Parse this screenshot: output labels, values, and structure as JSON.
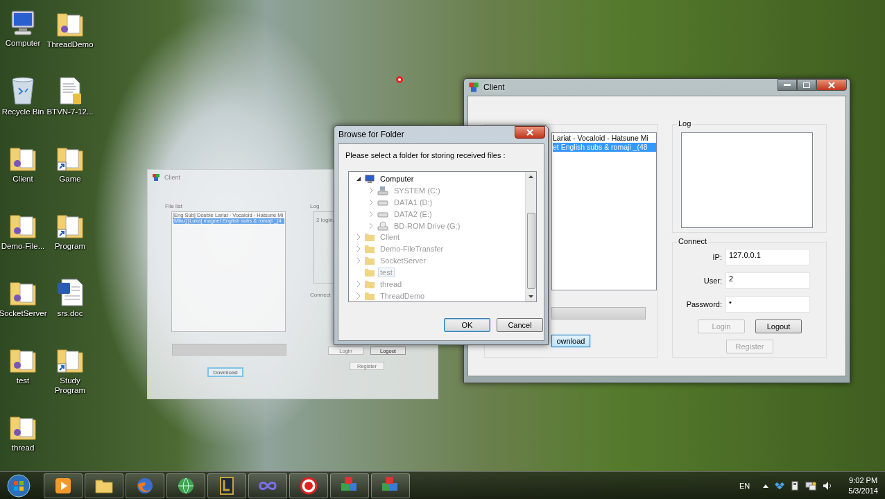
{
  "desktop_icons": [
    {
      "label": "Computer",
      "kind": "computer"
    },
    {
      "label": "Recycle Bin",
      "kind": "recycle"
    },
    {
      "label": "Client",
      "kind": "folder"
    },
    {
      "label": "Demo-File...",
      "kind": "folder"
    },
    {
      "label": "SocketServer",
      "kind": "folder"
    },
    {
      "label": "test",
      "kind": "folder"
    },
    {
      "label": "thread",
      "kind": "folder"
    },
    {
      "label": "ThreadDemo",
      "kind": "folder"
    },
    {
      "label": "BTVN-7-12...",
      "kind": "document"
    },
    {
      "label": "Game",
      "kind": "shortcut"
    },
    {
      "label": "Program",
      "kind": "shortcut"
    },
    {
      "label": "srs.doc",
      "kind": "word"
    },
    {
      "label": "Study Program",
      "kind": "shortcut"
    }
  ],
  "ghost_window": {
    "title": "Client",
    "file_list_label": "File list",
    "files": [
      {
        "name": "[Eng Sub] Double Lariat - Vocaloid - Hatsune Mi",
        "selected": false
      },
      {
        "name": "[Miku] [Luka] magnet English subs & romaji _(4",
        "selected": true
      }
    ],
    "progress": {
      "level": 0
    },
    "download_label": "Download",
    "log_label": "Log",
    "log_text": "2 login.",
    "connect_label": "Connect",
    "buttons": [
      {
        "label": "Login",
        "disabled": true
      },
      {
        "label": "Logout",
        "disabled": false
      },
      {
        "label": "Register",
        "disabled": true
      }
    ]
  },
  "browse_dialog": {
    "title": "Browse for Folder",
    "prompt": "Please select a folder for storing received files :",
    "tree": [
      {
        "label": "Computer",
        "kind": "computer",
        "has_children": true,
        "expanded": true,
        "selected": false,
        "children": [
          {
            "label": "SYSTEM (C:)",
            "kind": "system-drive",
            "has_children": true,
            "expanded": false,
            "selected": false
          },
          {
            "label": "DATA1 (D:)",
            "kind": "drive",
            "has_children": true,
            "expanded": false,
            "selected": false
          },
          {
            "label": "DATA2 (E:)",
            "kind": "drive",
            "has_children": true,
            "expanded": false,
            "selected": false
          },
          {
            "label": "BD-ROM Drive (G:)",
            "kind": "disc-drive",
            "has_children": true,
            "expanded": false,
            "selected": false
          }
        ]
      },
      {
        "label": "Client",
        "kind": "folder",
        "has_children": true,
        "expanded": false,
        "selected": false
      },
      {
        "label": "Demo-FileTransfer",
        "kind": "folder",
        "has_children": true,
        "expanded": false,
        "selected": false
      },
      {
        "label": "SocketServer",
        "kind": "folder",
        "has_children": true,
        "expanded": false,
        "selected": false
      },
      {
        "label": "test",
        "kind": "folder",
        "has_children": false,
        "expanded": false,
        "selected": true
      },
      {
        "label": "thread",
        "kind": "folder",
        "has_children": true,
        "expanded": false,
        "selected": false
      },
      {
        "label": "ThreadDemo",
        "kind": "folder",
        "has_children": true,
        "expanded": false,
        "selected": false
      }
    ],
    "buttons": [
      {
        "label": "OK",
        "default": true
      },
      {
        "label": "Cancel",
        "default": false
      }
    ]
  },
  "client_window": {
    "title": "Client",
    "files": [
      {
        "name": "Lariat - Vocaloid - Hatsune Mi",
        "selected": false
      },
      {
        "name": "et English subs & romaji _(48",
        "selected": true
      }
    ],
    "progress": {
      "level": 0
    },
    "download_label": "ownload",
    "log_label": "Log",
    "connect_label": "Connect",
    "fields": [
      {
        "label": "IP:",
        "value": "127.0.0.1"
      },
      {
        "label": "User:",
        "value": "2"
      },
      {
        "label": "Password:",
        "value": "•"
      }
    ],
    "buttons": [
      {
        "label": "Login",
        "disabled": true
      },
      {
        "label": "Logout",
        "disabled": false
      },
      {
        "label": "Register",
        "disabled": true
      }
    ]
  },
  "taskbar": {
    "apps": [
      {
        "kind": "media"
      },
      {
        "kind": "explorer"
      },
      {
        "kind": "browser"
      },
      {
        "kind": "globe"
      },
      {
        "kind": "emblem"
      },
      {
        "kind": "infinity"
      },
      {
        "kind": "record"
      },
      {
        "kind": "blocks"
      },
      {
        "kind": "blocks"
      }
    ],
    "language": "EN",
    "time": "9:02 PM",
    "date": "5/3/2014"
  }
}
